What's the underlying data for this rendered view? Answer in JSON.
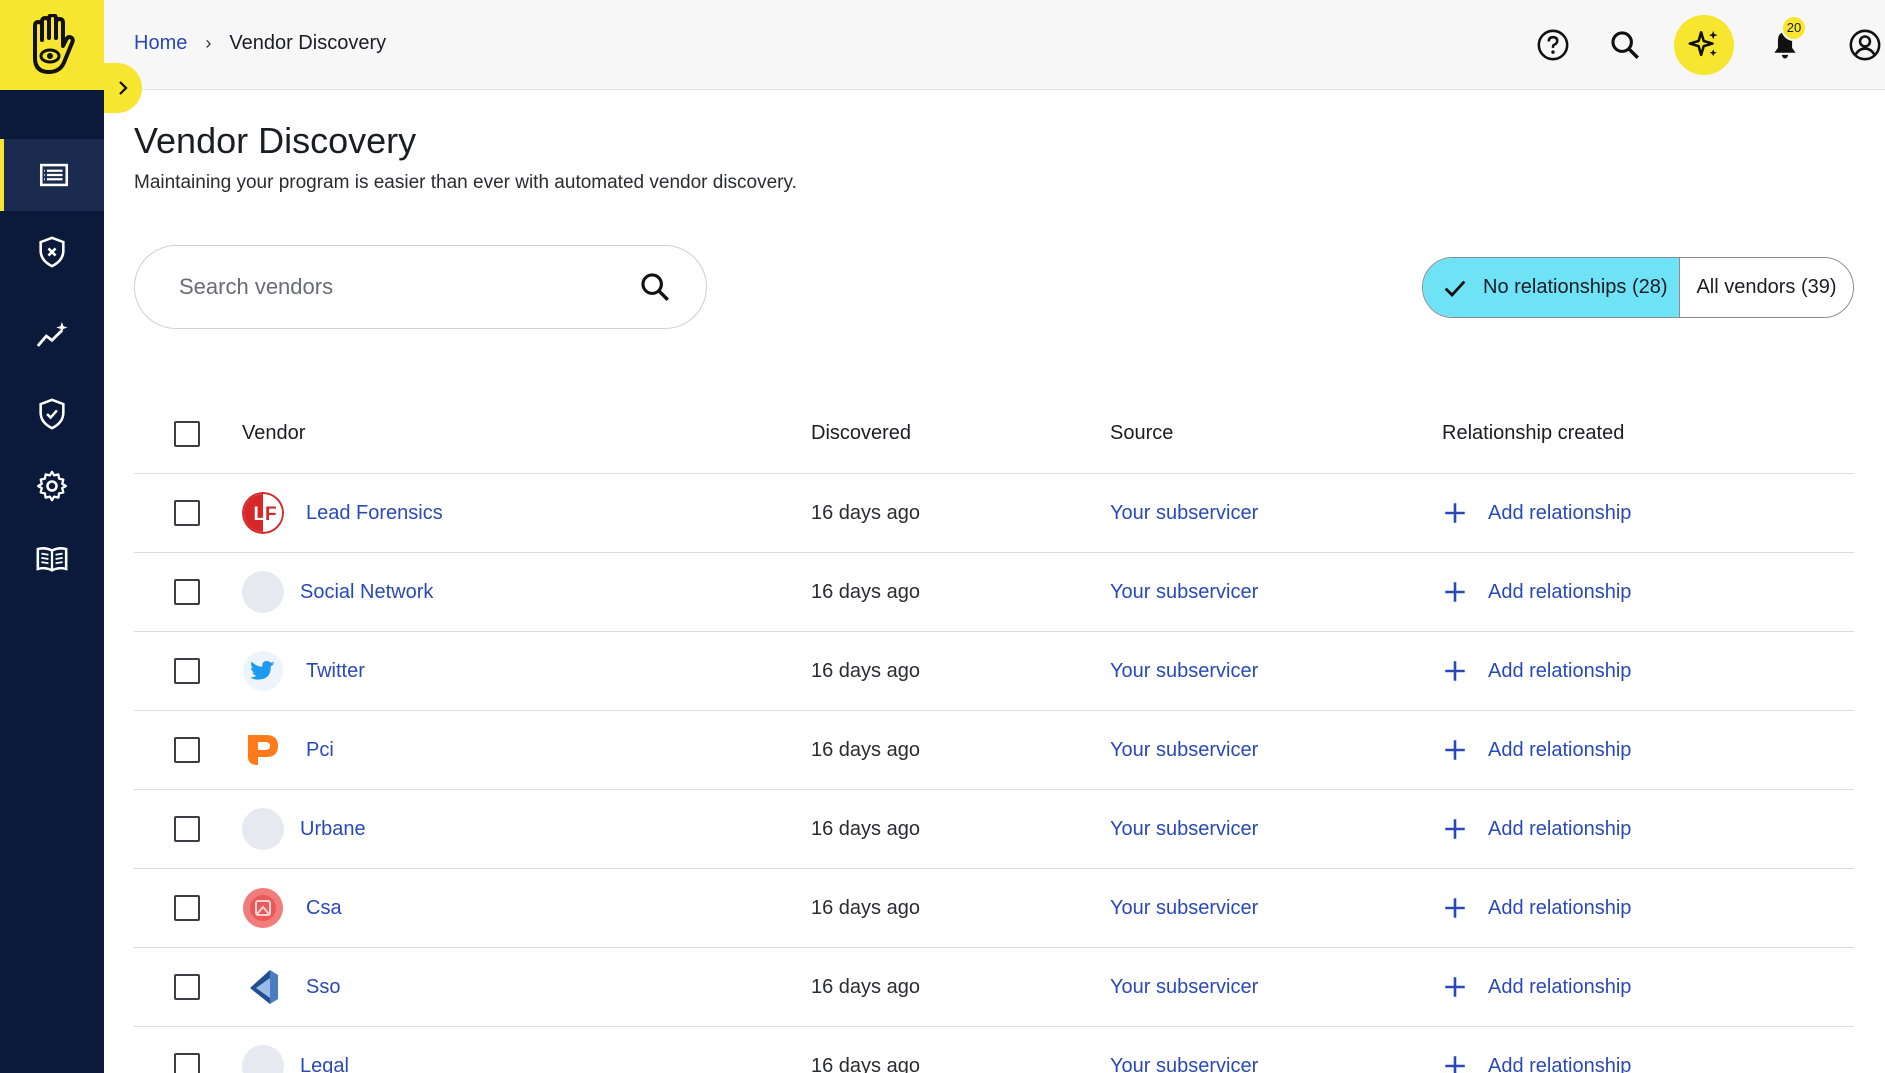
{
  "breadcrumb": {
    "home": "Home",
    "separator": "›",
    "current": "Vendor Discovery"
  },
  "header": {
    "notification_count": "20"
  },
  "page": {
    "title": "Vendor Discovery",
    "subtitle": "Maintaining your program is easier than ever with automated vendor discovery."
  },
  "search": {
    "placeholder": "Search vendors",
    "value": ""
  },
  "filter": {
    "selected_label": "No relationships (28)",
    "other_label": "All vendors (39)"
  },
  "table": {
    "columns": {
      "vendor": "Vendor",
      "discovered": "Discovered",
      "source": "Source",
      "relationship": "Relationship created"
    },
    "rows": [
      {
        "vendor": "Lead Forensics",
        "logo": "lead-forensics-logo",
        "discovered": "16 days ago",
        "source": "Your subservicer",
        "action": "Add relationship"
      },
      {
        "vendor": "Social Network",
        "logo": "blank-logo",
        "discovered": "16 days ago",
        "source": "Your subservicer",
        "action": "Add relationship"
      },
      {
        "vendor": "Twitter",
        "logo": "twitter-logo",
        "discovered": "16 days ago",
        "source": "Your subservicer",
        "action": "Add relationship"
      },
      {
        "vendor": "Pci",
        "logo": "pci-logo",
        "discovered": "16 days ago",
        "source": "Your subservicer",
        "action": "Add relationship"
      },
      {
        "vendor": "Urbane",
        "logo": "blank-logo",
        "discovered": "16 days ago",
        "source": "Your subservicer",
        "action": "Add relationship"
      },
      {
        "vendor": "Csa",
        "logo": "csa-logo",
        "discovered": "16 days ago",
        "source": "Your subservicer",
        "action": "Add relationship"
      },
      {
        "vendor": "Sso",
        "logo": "sso-logo",
        "discovered": "16 days ago",
        "source": "Your subservicer",
        "action": "Add relationship"
      },
      {
        "vendor": "Legal",
        "logo": "blank-logo",
        "discovered": "16 days ago",
        "source": "Your subservicer",
        "action": "Add relationship"
      }
    ]
  },
  "colors": {
    "brand_yellow": "#f7e630",
    "sidebar": "#0b1a3a",
    "link": "#2a49b8",
    "selected_filter": "#6fe3f6"
  }
}
